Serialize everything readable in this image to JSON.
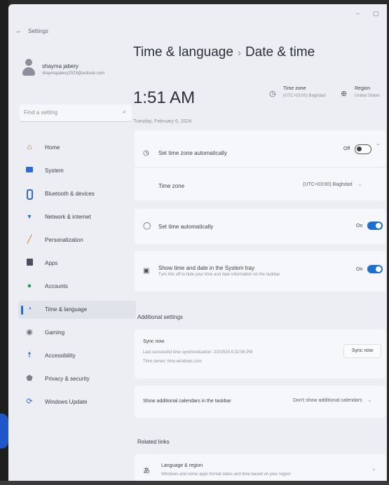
{
  "window": {
    "app_title": "Settings",
    "minimize_glyph": "–",
    "maximize_glyph": "▢"
  },
  "user": {
    "name": "shayma jabery",
    "email": "shaymajabery2023@outlook.com"
  },
  "search": {
    "placeholder": "Find a setting"
  },
  "sidebar": {
    "items": [
      {
        "label": "Home",
        "icon": "home-icon",
        "color": "#c0582a"
      },
      {
        "label": "System",
        "icon": "system-icon",
        "color": "#2f6bd6"
      },
      {
        "label": "Bluetooth & devices",
        "icon": "bluetooth-icon",
        "color": "#2f6bd6"
      },
      {
        "label": "Network & internet",
        "icon": "network-icon",
        "color": "#3a6fd0"
      },
      {
        "label": "Personalization",
        "icon": "brush-icon",
        "color": "#c0702a"
      },
      {
        "label": "Apps",
        "icon": "apps-icon",
        "color": "#4a5060"
      },
      {
        "label": "Accounts",
        "icon": "accounts-icon",
        "color": "#2f9a5a"
      },
      {
        "label": "Time & language",
        "icon": "globe-clock-icon",
        "color": "#2f6bd6",
        "active": true
      },
      {
        "label": "Gaming",
        "icon": "gaming-icon",
        "color": "#6a6f7a"
      },
      {
        "label": "Accessibility",
        "icon": "accessibility-icon",
        "color": "#2f6bd6"
      },
      {
        "label": "Privacy & security",
        "icon": "shield-icon",
        "color": "#7a7f8a"
      },
      {
        "label": "Windows Update",
        "icon": "update-icon",
        "color": "#2f6bd6"
      }
    ]
  },
  "header": {
    "breadcrumb_parent": "Time & language",
    "breadcrumb_separator": "›",
    "breadcrumb_current": "Date & time",
    "clock": "1:51 AM",
    "date": "Tuesday, February 6, 2024",
    "time_zone_title": "Time zone",
    "time_zone_value": "(UTC+03:00) Baghdad",
    "region_title": "Region",
    "region_value": "United States"
  },
  "settings": {
    "auto_timezone_label": "Set time zone automatically",
    "auto_timezone_state": "Off",
    "time_zone_label": "Time zone",
    "time_zone_value": "(UTC+03:00) Baghdad",
    "auto_time_label": "Set time automatically",
    "auto_time_state": "On",
    "tray_label": "Show time and date in the System tray",
    "tray_sub": "Turn this off to hide your time and date information on the taskbar",
    "tray_state": "On"
  },
  "additional": {
    "title": "Additional settings",
    "sync_title": "Sync now",
    "sync_last": "Last successful time synchronization: 2/2/2024 6:32:56 PM",
    "sync_server": "Time server: time.windows.com",
    "sync_button": "Sync now",
    "calendars_label": "Show additional calendars in the taskbar",
    "calendars_value": "Don't show additional calendars"
  },
  "related": {
    "title": "Related links",
    "item_label": "Language & region",
    "item_sub": "Windows and some apps format dates and time based on your region"
  }
}
